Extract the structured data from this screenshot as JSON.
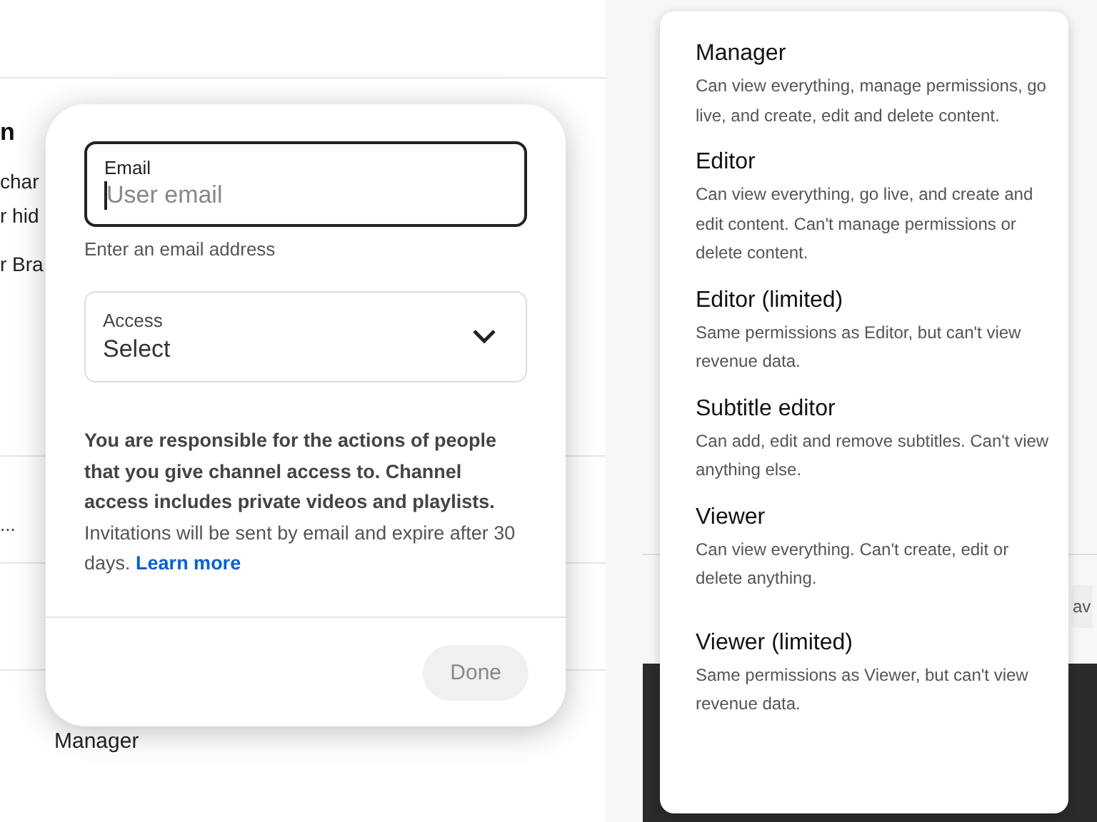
{
  "background_page": {
    "heading": "n",
    "lines": [
      "char",
      "r hid",
      "r Bra"
    ],
    "row_text": "...",
    "role_label": "Manager",
    "right_button": "av"
  },
  "invite_dialog": {
    "email_field": {
      "label": "Email",
      "placeholder": "User email",
      "helper": "Enter an email address",
      "focused": true
    },
    "access_field": {
      "label": "Access",
      "value": "Select"
    },
    "notice_bold": "You are responsible for the actions of people that you give channel access to. Channel access includes private videos and playlists.",
    "notice": "Invitations will be sent by email and expire after 30 days.",
    "learn_more": "Learn more",
    "done_button": {
      "label": "Done",
      "disabled": true
    }
  },
  "role_menu": [
    {
      "title": "Manager",
      "description": "Can view everything, manage permissions, go live, and create, edit and delete content."
    },
    {
      "title": "Editor",
      "description": "Can view everything, go live, and create and edit content. Can't manage permissions or delete content."
    },
    {
      "title": "Editor (limited)",
      "description": "Same permissions as Editor, but can't view revenue data."
    },
    {
      "title": "Subtitle editor",
      "description": "Can add, edit and remove subtitles. Can't view anything else."
    },
    {
      "title": "Viewer",
      "description": "Can view everything. Can't create, edit or delete anything."
    },
    {
      "title": "Viewer (limited)",
      "description": "Same permissions as Viewer, but can't view revenue data."
    }
  ]
}
